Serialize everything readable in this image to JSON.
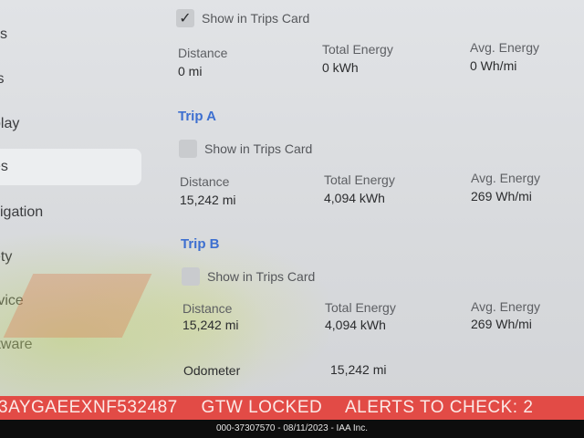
{
  "sidebar": {
    "items": [
      {
        "label": "ks"
      },
      {
        "label": "ts"
      },
      {
        "label": "play"
      },
      {
        "label": "es"
      },
      {
        "label": "vigation"
      },
      {
        "label": "ety"
      },
      {
        "label": "rvice"
      },
      {
        "label": "ftware"
      }
    ]
  },
  "current_trip": {
    "show_in_trips_label": "Show in Trips Card",
    "show_in_trips_checked": true,
    "distance_label": "Distance",
    "distance_value": "0 mi",
    "energy_label": "Total Energy",
    "energy_value": "0 kWh",
    "avg_label": "Avg. Energy",
    "avg_value": "0 Wh/mi"
  },
  "trip_a": {
    "title": "Trip A",
    "show_in_trips_label": "Show in Trips Card",
    "show_in_trips_checked": false,
    "distance_label": "Distance",
    "distance_value": "15,242 mi",
    "energy_label": "Total Energy",
    "energy_value": "4,094 kWh",
    "avg_label": "Avg. Energy",
    "avg_value": "269 Wh/mi"
  },
  "trip_b": {
    "title": "Trip B",
    "show_in_trips_label": "Show in Trips Card",
    "show_in_trips_checked": false,
    "distance_label": "Distance",
    "distance_value": "15,242 mi",
    "energy_label": "Total Energy",
    "energy_value": "4,094 kWh",
    "avg_label": "Avg. Energy",
    "avg_value": "269 Wh/mi"
  },
  "odometer": {
    "label": "Odometer",
    "value": "15,242 mi"
  },
  "alert_bar": {
    "vin": "3AYGAEEXNF532487",
    "lock_status": "GTW LOCKED",
    "alerts": "ALERTS TO CHECK: 2"
  },
  "footer": {
    "text": "000-37307570 - 08/11/2023 - IAA Inc."
  },
  "colors": {
    "accent": "#3d6fd0",
    "alert_bar": "#e24b46",
    "footer_bg": "#0d0d0d"
  }
}
